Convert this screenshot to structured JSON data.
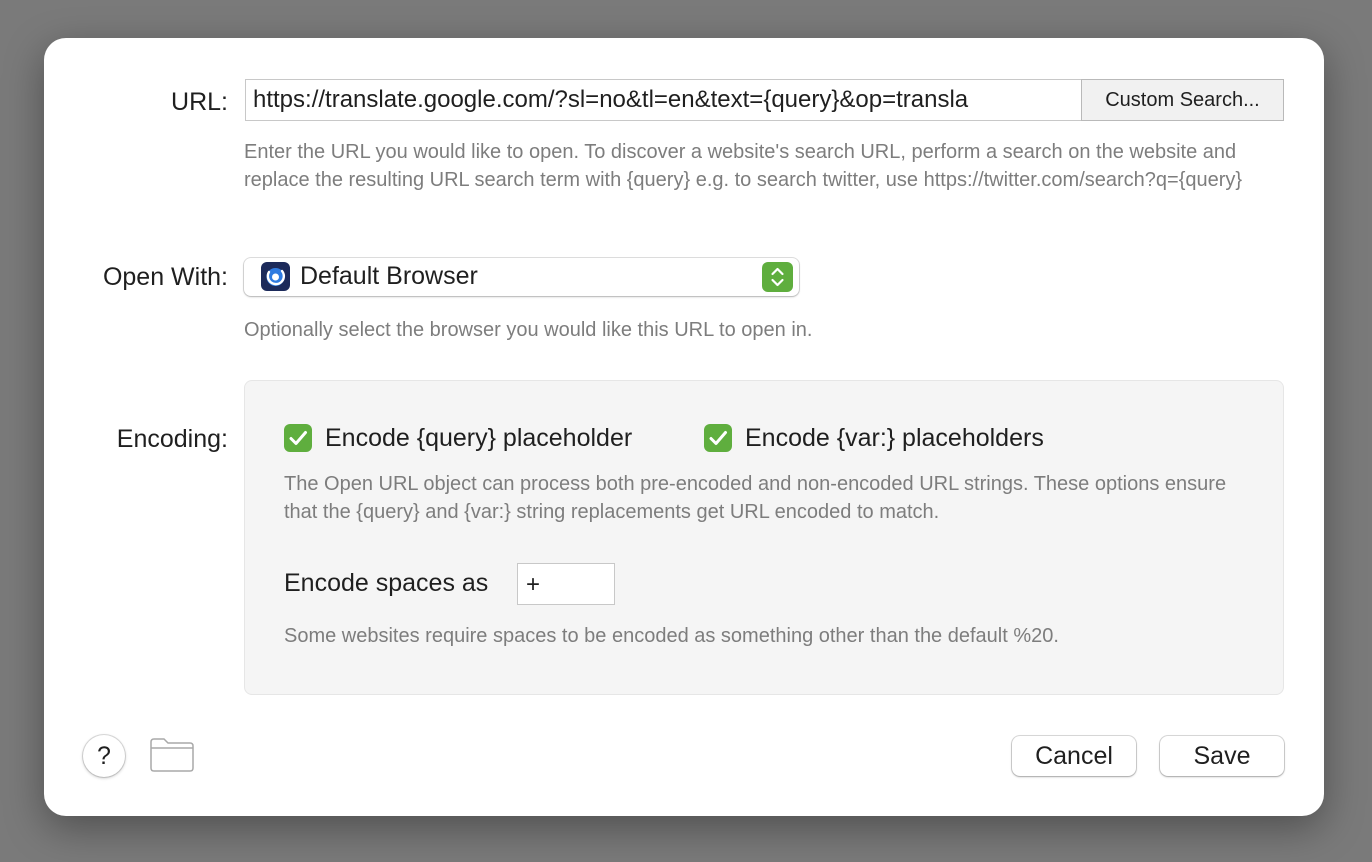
{
  "url": {
    "label": "URL:",
    "value": "https://translate.google.com/?sl=no&tl=en&text={query}&op=transla",
    "custom_search_label": "Custom Search...",
    "help": "Enter the URL you would like to open. To discover a website's search URL, perform a search on the website and replace the resulting URL search term with {query} e.g. to search twitter, use https://twitter.com/search?q={query}"
  },
  "open_with": {
    "label": "Open With:",
    "selected": "Default Browser",
    "icon": "default-browser-icon",
    "help": "Optionally select the browser you would like this URL to open in."
  },
  "encoding": {
    "label": "Encoding:",
    "encode_query_label": "Encode {query} placeholder",
    "encode_query_checked": true,
    "encode_vars_label": "Encode {var:} placeholders",
    "encode_vars_checked": true,
    "help": "The Open URL object can process both pre-encoded and non-encoded URL strings. These options ensure that the {query} and {var:} string replacements get URL encoded to match.",
    "spaces_label": "Encode spaces as",
    "spaces_value": "+",
    "spaces_help": "Some websites require spaces to be encoded as something other than the default %20."
  },
  "footer": {
    "help_label": "?",
    "cancel_label": "Cancel",
    "save_label": "Save"
  },
  "colors": {
    "accent_green": "#5fae3e",
    "backdrop": "#7a7a7a",
    "help_text": "#7d7d7d"
  }
}
